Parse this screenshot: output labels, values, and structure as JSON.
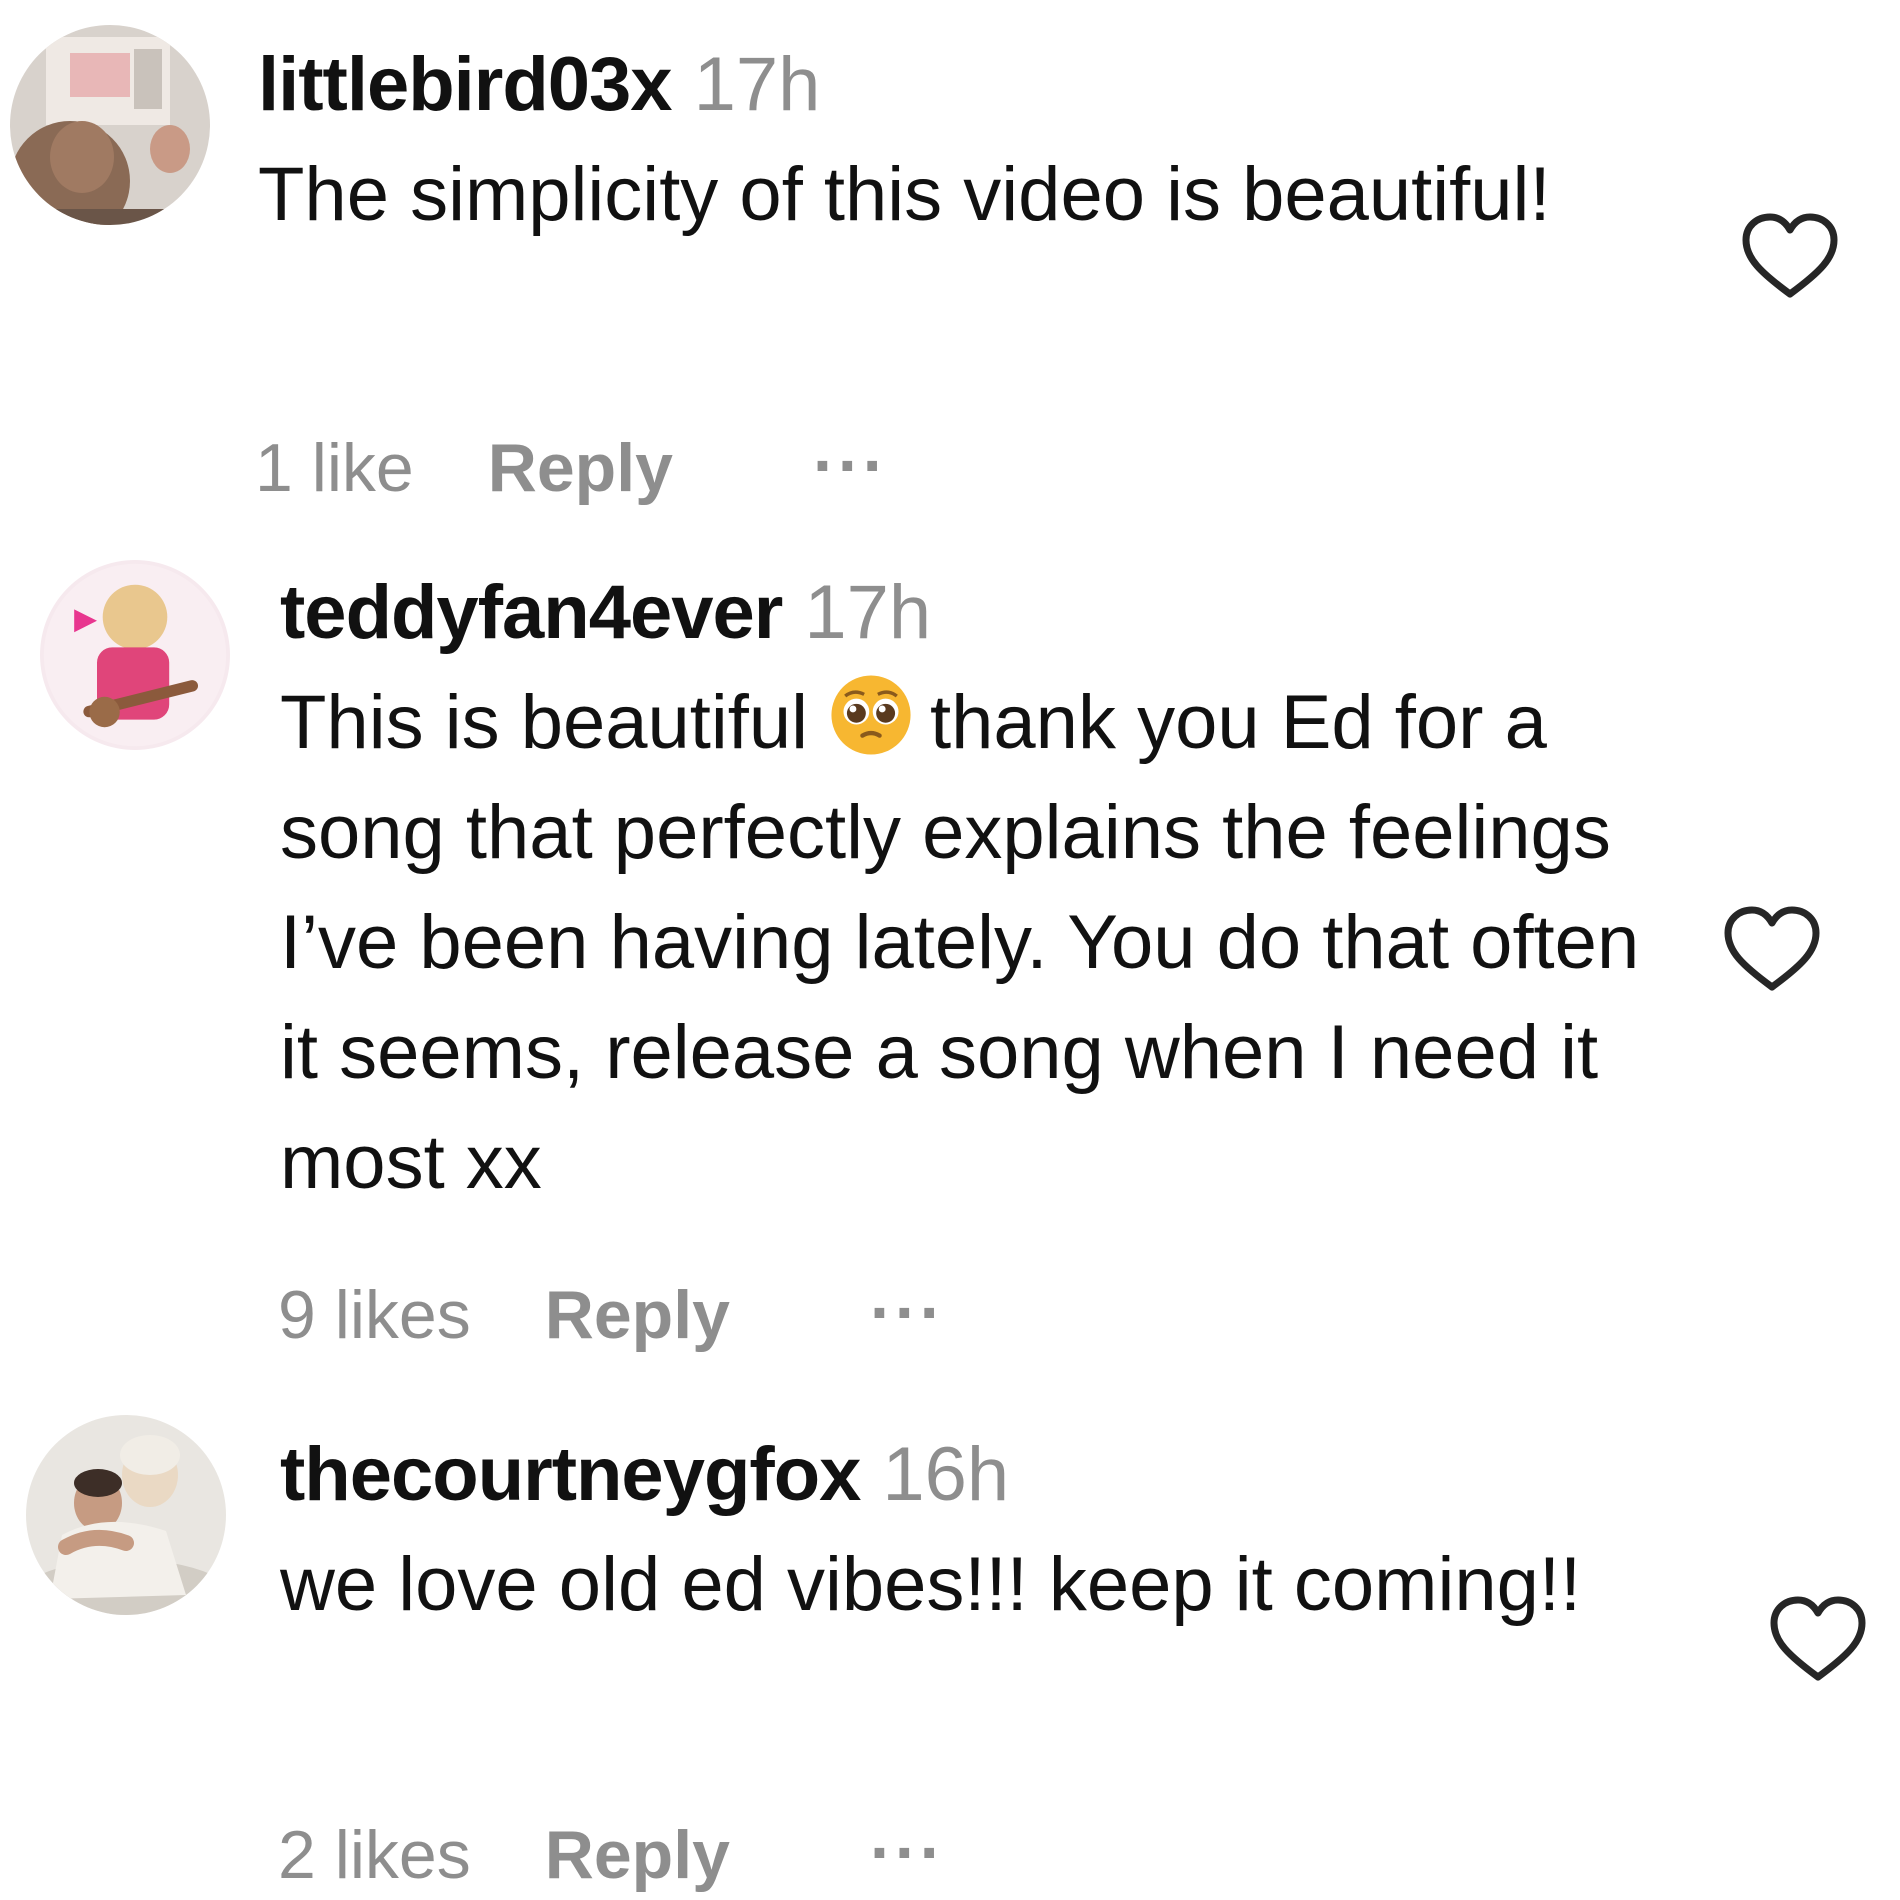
{
  "colors": {
    "text": "#111111",
    "secondary": "#8e8e8e",
    "background": "#ffffff"
  },
  "comments": [
    {
      "username": "littlebird03x",
      "time": "17h",
      "text": "The simplicity of this video is beautiful!",
      "likes": "1 like",
      "reply": "Reply",
      "more": "...",
      "avatar_icon": "user-avatar",
      "like_icon": "heart-outline-icon"
    },
    {
      "username": "teddyfan4ever",
      "time": "17h",
      "text_before_emoji": "This is beautiful",
      "emoji": "pleading-face-emoji",
      "text_after_emoji": "thank you Ed for a song that perfectly explains the feelings I’ve been having lately. You do that often it seems, release a song when I need it most xx",
      "likes": "9 likes",
      "reply": "Reply",
      "more": "...",
      "avatar_icon": "user-avatar",
      "like_icon": "heart-outline-icon"
    },
    {
      "username": "thecourtneygfox",
      "time": "16h",
      "text": "we love old ed vibes!!! keep it coming!!",
      "likes": "2 likes",
      "reply": "Reply",
      "more": "...",
      "avatar_icon": "user-avatar",
      "like_icon": "heart-outline-icon"
    }
  ]
}
